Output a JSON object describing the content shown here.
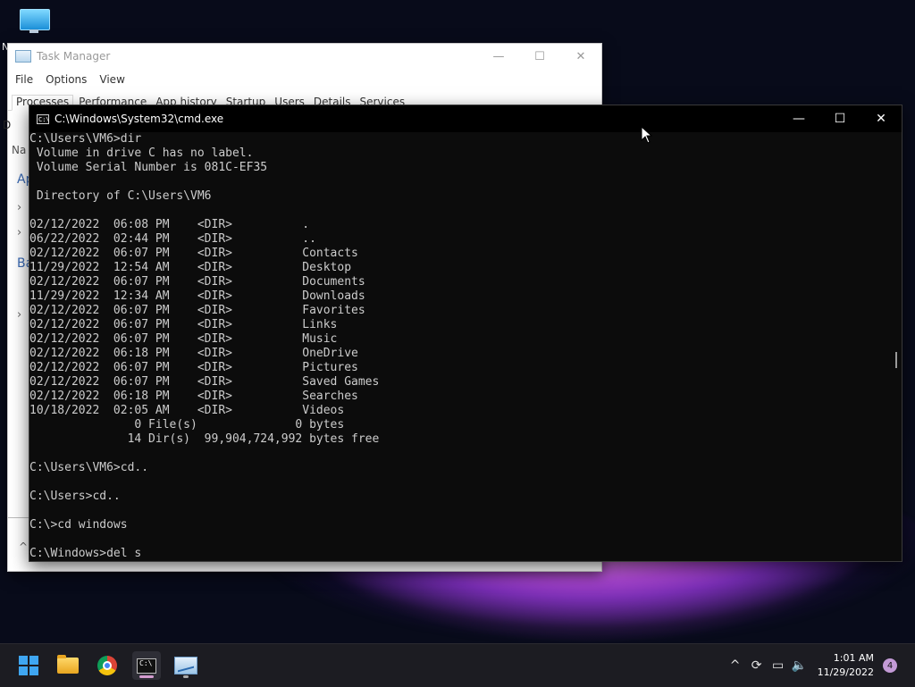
{
  "desktop": {
    "icon": "this-pc-icon",
    "partial_label": "N"
  },
  "task_manager": {
    "title": "Task Manager",
    "menu": [
      "File",
      "Options",
      "View"
    ],
    "tabs": [
      "Processes",
      "Performance",
      "App history",
      "Startup",
      "Users",
      "Details",
      "Services"
    ],
    "side_fragments": [
      "D",
      "Na",
      "Ap",
      "Ba"
    ]
  },
  "cmd": {
    "title": "C:\\Windows\\System32\\cmd.exe",
    "lines": [
      "C:\\Users\\VM6>dir",
      " Volume in drive C has no label.",
      " Volume Serial Number is 081C-EF35",
      "",
      " Directory of C:\\Users\\VM6",
      "",
      "02/12/2022  06:08 PM    <DIR>          .",
      "06/22/2022  02:44 PM    <DIR>          ..",
      "02/12/2022  06:07 PM    <DIR>          Contacts",
      "11/29/2022  12:54 AM    <DIR>          Desktop",
      "02/12/2022  06:07 PM    <DIR>          Documents",
      "11/29/2022  12:34 AM    <DIR>          Downloads",
      "02/12/2022  06:07 PM    <DIR>          Favorites",
      "02/12/2022  06:07 PM    <DIR>          Links",
      "02/12/2022  06:07 PM    <DIR>          Music",
      "02/12/2022  06:18 PM    <DIR>          OneDrive",
      "02/12/2022  06:07 PM    <DIR>          Pictures",
      "02/12/2022  06:07 PM    <DIR>          Saved Games",
      "02/12/2022  06:18 PM    <DIR>          Searches",
      "10/18/2022  02:05 AM    <DIR>          Videos",
      "               0 File(s)              0 bytes",
      "              14 Dir(s)  99,904,724,992 bytes free",
      "",
      "C:\\Users\\VM6>cd..",
      "",
      "C:\\Users>cd..",
      "",
      "C:\\>cd windows",
      "",
      "C:\\Windows>del s"
    ]
  },
  "taskbar": {
    "items": [
      {
        "name": "start-button",
        "icon": "windows-logo-icon"
      },
      {
        "name": "file-explorer-button",
        "icon": "folder-icon"
      },
      {
        "name": "chrome-button",
        "icon": "chrome-icon"
      },
      {
        "name": "cmd-taskbar-button",
        "icon": "cmd-icon"
      },
      {
        "name": "task-manager-taskbar-button",
        "icon": "task-manager-icon"
      }
    ],
    "tray": {
      "chevron": "^",
      "time": "1:01 AM",
      "date": "11/29/2022",
      "notification_count": "4"
    }
  }
}
